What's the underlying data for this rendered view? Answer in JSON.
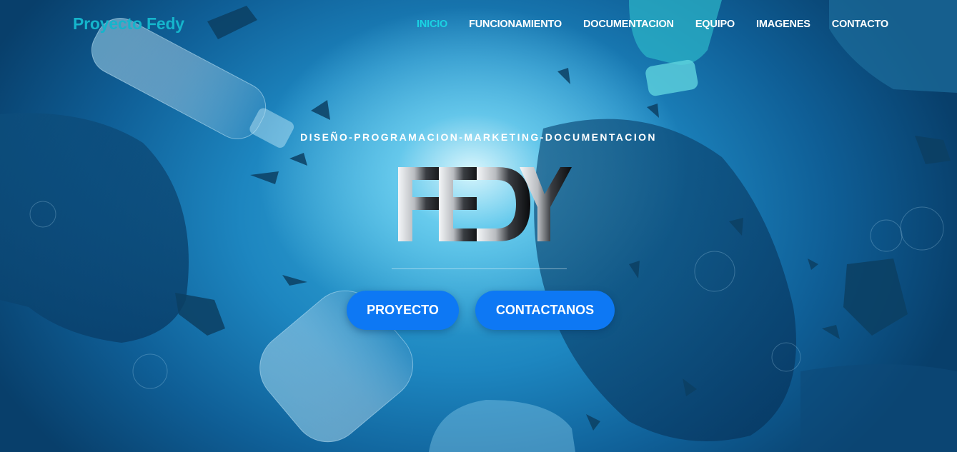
{
  "colors": {
    "brand": "#15b5cc",
    "nav_active": "#1ad3e3",
    "button": "#0d78f4",
    "text": "#ffffff"
  },
  "navbar": {
    "brand": "Proyecto Fedy",
    "links": [
      {
        "label": "INICIO",
        "active": true
      },
      {
        "label": "FUNCIONAMIENTO",
        "active": false
      },
      {
        "label": "DOCUMENTACION",
        "active": false
      },
      {
        "label": "EQUIPO",
        "active": false
      },
      {
        "label": "IMAGENES",
        "active": false
      },
      {
        "label": "CONTACTO",
        "active": false
      }
    ]
  },
  "hero": {
    "tagline": "DISEÑO-PROGRAMACION-MARKETING-DOCUMENTACION",
    "logo_text": "FEDY",
    "buttons": {
      "primary": "PROYECTO",
      "secondary": "CONTACTANOS"
    }
  }
}
